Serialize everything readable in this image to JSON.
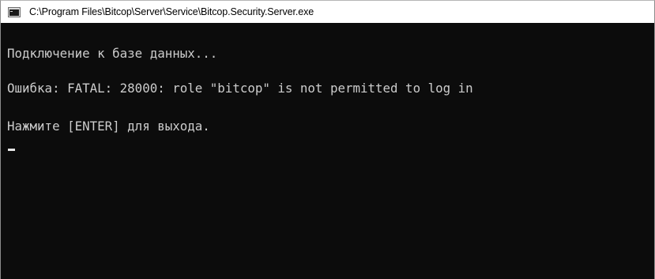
{
  "window": {
    "title": "C:\\Program Files\\Bitcop\\Server\\Service\\Bitcop.Security.Server.exe",
    "icon": "console-app-icon"
  },
  "console": {
    "lines": [
      "Подключение к базе данных...",
      "Ошибка: FATAL: 28000: role \"bitcop\" is not permitted to log in",
      "Нажмите [ENTER] для выхода."
    ],
    "background": "#0c0c0c",
    "foreground": "#cccccc"
  }
}
